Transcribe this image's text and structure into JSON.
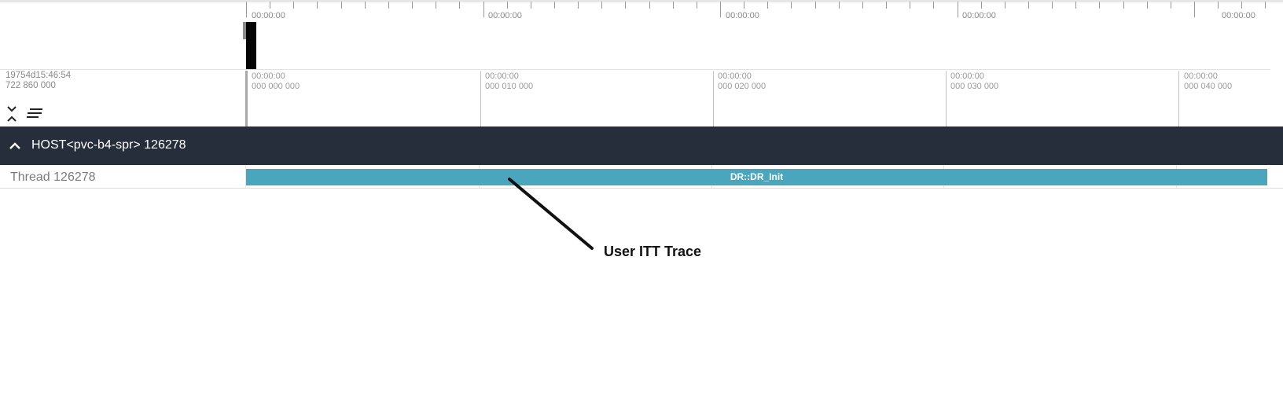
{
  "overview": {
    "labels": [
      "00:00:00",
      "00:00:00",
      "00:00:00",
      "00:00:00",
      "00:00:00"
    ]
  },
  "ruler": {
    "timecode_line1": "19754d15:46:54",
    "timecode_line2": "722 860 000",
    "ticks": [
      {
        "time": "00:00:00",
        "ns": "000 000 000"
      },
      {
        "time": "00:00:00",
        "ns": "000 010 000"
      },
      {
        "time": "00:00:00",
        "ns": "000 020 000"
      },
      {
        "time": "00:00:00",
        "ns": "000 030 000"
      },
      {
        "time": "00:00:00",
        "ns": "000 040 000"
      }
    ]
  },
  "toolbar": {
    "collapse_icon": "collapse-expand-icon",
    "sort_icon": "sort-lines-icon"
  },
  "host": {
    "title": "HOST<pvc-b4-spr> 126278",
    "toggle_icon": "chevron-up-icon",
    "background": "#262e3b"
  },
  "thread": {
    "label": "Thread 126278",
    "task": {
      "name": "DR::DR_Init",
      "color": "#49a6bd"
    }
  },
  "annotation": {
    "text": "User ITT Trace"
  }
}
